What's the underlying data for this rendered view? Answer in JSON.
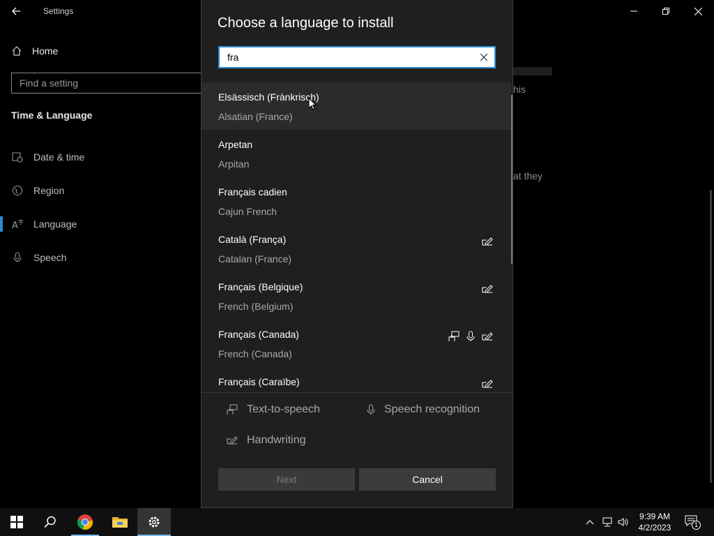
{
  "window": {
    "app_title": "Settings"
  },
  "sidebar": {
    "home_label": "Home",
    "search_placeholder": "Find a setting",
    "section_title": "Time & Language",
    "items": [
      {
        "label": "Date & time",
        "icon": "calendar-clock-icon"
      },
      {
        "label": "Region",
        "icon": "globe-icon"
      },
      {
        "label": "Language",
        "icon": "language-icon",
        "selected": true
      },
      {
        "label": "Speech",
        "icon": "microphone-icon"
      }
    ]
  },
  "background_text": {
    "line1": "his",
    "line2": "at they"
  },
  "dialog": {
    "title": "Choose a language to install",
    "search_value": "fra",
    "languages": [
      {
        "native": "Elsässisch (Frànkrisch)",
        "english": "Alsatian (France)",
        "features": [],
        "hovered": true
      },
      {
        "native": "Arpetan",
        "english": "Arpitan",
        "features": []
      },
      {
        "native": "Français cadien",
        "english": "Cajun French",
        "features": []
      },
      {
        "native": "Català (França)",
        "english": "Catalan (France)",
        "features": [
          "handwriting"
        ]
      },
      {
        "native": "Français (Belgique)",
        "english": "French (Belgium)",
        "features": [
          "handwriting"
        ]
      },
      {
        "native": "Français (Canada)",
        "english": "French (Canada)",
        "features": [
          "text-to-speech",
          "speech-recognition",
          "handwriting"
        ]
      },
      {
        "native": "Français (Caraïbe)",
        "english": "",
        "features": [
          "handwriting"
        ]
      }
    ],
    "legend": {
      "tts": "Text-to-speech",
      "speech": "Speech recognition",
      "handwriting": "Handwriting"
    },
    "next_label": "Next",
    "cancel_label": "Cancel"
  },
  "taskbar": {
    "time": "9:39 AM",
    "date": "4/2/2023",
    "notification_count": "1",
    "accent_color": "#76b9ed"
  }
}
